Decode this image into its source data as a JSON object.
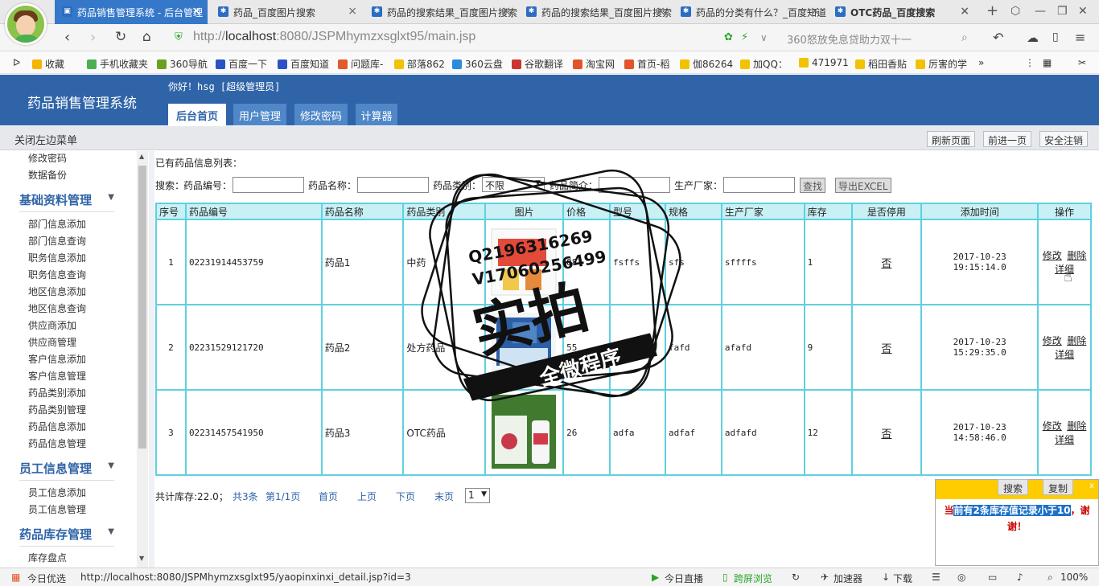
{
  "browser": {
    "tabs": [
      {
        "label": "药品销售管理系统 - 后台管理",
        "active": true
      },
      {
        "label": "药品_百度图片搜索",
        "active": false
      },
      {
        "label": "药品的搜索结果_百度图片搜索",
        "active": false
      },
      {
        "label": "药品的搜索结果_百度图片搜索",
        "active": false
      },
      {
        "label": "药品的分类有什么？_百度知道",
        "active": false
      },
      {
        "label": "OTC药品_百度搜索",
        "active": false
      }
    ],
    "url_prefix": "http://",
    "url_host": "localhost",
    "url_rest": ":8080/JSPMhymzxsglxt95/main.jsp",
    "search_hint": "360怒放免息贷助力双十一",
    "bookmarks": [
      "收藏",
      "手机收藏夹",
      "360导航",
      "百度一下",
      "百度知道",
      "问题库-",
      "部落862",
      "360云盘",
      "谷歌翻译",
      "淘宝网",
      "首页-稻",
      "伽86264",
      "加QQ：",
      "471971",
      "稻田香贴",
      "厉害的学"
    ],
    "status_url": "http://localhost:8080/JSPMhymzxsglxt95/yaopinxinxi_detail.jsp?id=3",
    "status_left": "今日优选",
    "status_items": [
      "今日直播",
      "跨屏浏览",
      "加速器",
      "下载",
      "100%"
    ]
  },
  "header": {
    "system_name": "药品销售管理系统",
    "greeting": "你好！hsg [超级管理员]",
    "menus": [
      "后台首页",
      "用户管理",
      "修改密码",
      "计算器"
    ]
  },
  "toolbar": {
    "close_left": "关闭左边菜单",
    "buttons": [
      "刷新页面",
      "前进一页",
      "安全注销"
    ]
  },
  "sidebar": {
    "top_items": [
      "修改密码",
      "数据备份"
    ],
    "groups": [
      {
        "title": "基础资料管理",
        "items": [
          "部门信息添加",
          "部门信息查询",
          "职务信息添加",
          "职务信息查询",
          "地区信息添加",
          "地区信息查询",
          "供应商添加",
          "供应商管理",
          "客户信息添加",
          "客户信息管理",
          "药品类别添加",
          "药品类别管理",
          "药品信息添加",
          "药品信息管理"
        ]
      },
      {
        "title": "员工信息管理",
        "items": [
          "员工信息添加",
          "员工信息管理"
        ]
      },
      {
        "title": "药品库存管理",
        "items": [
          "库存盘点"
        ]
      }
    ]
  },
  "content": {
    "title": "已有药品信息列表：",
    "search": {
      "label": "搜索：",
      "code_label": "药品编号：",
      "name_label": "药品名称：",
      "category_label": "药品类别：",
      "category_value": "不限",
      "intro_label": "药品简介：",
      "maker_label": "生产厂家：",
      "find_button": "查找",
      "export_button": "导出EXCEL"
    },
    "columns": [
      "序号",
      "药品编号",
      "药品名称",
      "药品类别",
      "图片",
      "价格",
      "型号",
      "规格",
      "生产厂家",
      "库存",
      "是否停用",
      "添加时间",
      "操作"
    ],
    "rows": [
      {
        "no": "1",
        "code": "02231914453759",
        "name": "药品1",
        "category": "中药",
        "price": "88",
        "model": "fsffs",
        "spec": "sfs",
        "maker": "sffffs",
        "stock": "1",
        "disabled": "否",
        "time": "2017-10-23 19:15:14.0",
        "edit": "修改",
        "delete": "删除",
        "detail": "详细"
      },
      {
        "no": "2",
        "code": "02231529121720",
        "name": "药品2",
        "category": "处方药品",
        "price": "55",
        "model": "",
        "spec": "fafd",
        "maker": "afafd",
        "stock": "9",
        "disabled": "否",
        "time": "2017-10-23 15:29:35.0",
        "edit": "修改",
        "delete": "删除",
        "detail": "详细"
      },
      {
        "no": "3",
        "code": "02231457541950",
        "name": "药品3",
        "category": "OTC药品",
        "price": "26",
        "model": "adfa",
        "spec": "adfaf",
        "maker": "adfafd",
        "stock": "12",
        "disabled": "否",
        "time": "2017-10-23 14:58:46.0",
        "edit": "修改",
        "delete": "删除",
        "detail": "详细"
      }
    ],
    "pager": {
      "total_stock": "共计库存:22.0；",
      "total": "共3条",
      "page": "第1/1页",
      "first": "首页",
      "prev": "上页",
      "next": "下页",
      "last": "末页",
      "page_select": "1"
    }
  },
  "popup": {
    "context_buttons": [
      "搜索",
      "复制"
    ],
    "message_pre": "当",
    "message_highlight": "前有2条库存值记录小于10",
    "message_post": "，谢谢！",
    "close": "x"
  },
  "watermark": {
    "line1": "Q2196316269",
    "line2": "V17060256499",
    "big": "实拍",
    "ribbon": "全微程序"
  }
}
